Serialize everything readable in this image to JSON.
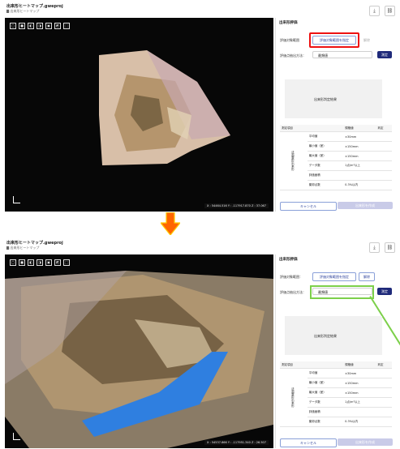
{
  "screens": [
    {
      "title": "出来形ヒートマップ.gweproj",
      "breadcrumb": "出来形ヒートマップ",
      "panel_title": "出来形評価",
      "label_range": "評価対象範囲",
      "btn_set_range": "評価対象範囲を指定",
      "btn_release": "解除",
      "label_method": "評価点抽出方法：",
      "method_value": "最頻値",
      "btn_measure": "測定",
      "result_placeholder": "出来形判定結果",
      "coords": "X : 54464.516  Y : -117917.870  Z : 37.067"
    },
    {
      "title": "出来形ヒートマップ.gweproj",
      "breadcrumb": "出来形ヒートマップ",
      "panel_title": "出来形評価",
      "label_range": "評価対象範囲：",
      "btn_set_range": "評価対象範囲を指定",
      "btn_release": "解除",
      "label_method": "評価点抽出方法：",
      "method_value": "最頻値",
      "btn_measure": "測定",
      "result_placeholder": "出来形判定結果",
      "coords": "X : 54537.866  Y : -117951.340  Z : 26.507"
    }
  ],
  "table": {
    "headers": [
      "測定項目",
      "",
      "規格値",
      "判定"
    ],
    "category": "法面整形出来形",
    "rows": [
      {
        "item": "平均値",
        "spec": "±30mm"
      },
      {
        "item": "最小値（差）",
        "spec": "±150mm"
      },
      {
        "item": "最大値（差）",
        "spec": "±150mm"
      },
      {
        "item": "データ数",
        "spec": "1点/m²以上"
      },
      {
        "item": "評価面積",
        "spec": ""
      },
      {
        "item": "棄却点数",
        "spec": "0.3%以内"
      }
    ]
  },
  "footer": {
    "cancel": "キャンセル",
    "create": "出来形を作成"
  },
  "toolbar_icons": [
    "download-icon",
    "link-icon"
  ],
  "view_tools": [
    "□",
    "■",
    "◧",
    "◨",
    "▣",
    "◩",
    "⬚"
  ],
  "colors": {
    "highlight_red": "#e11111",
    "highlight_green": "#7cd04a",
    "accent": "#1f2a7a",
    "arrow": "#ff6600"
  }
}
